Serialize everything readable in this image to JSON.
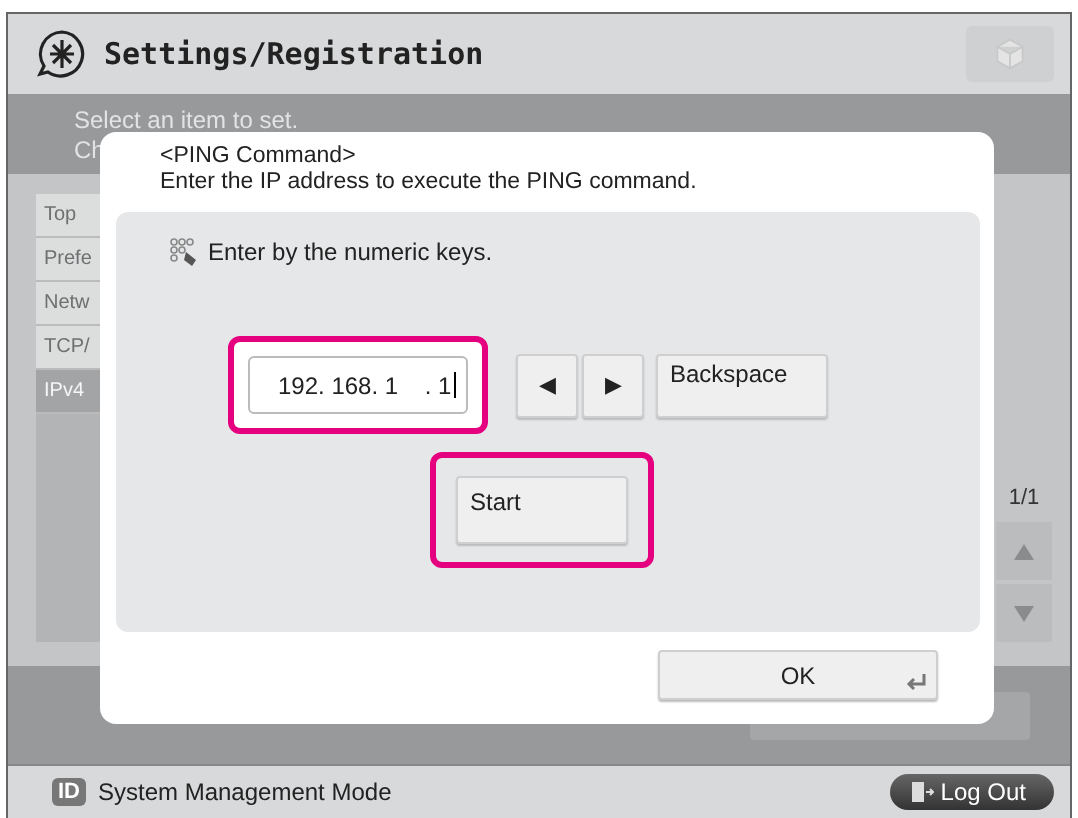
{
  "header": {
    "title": "Settings/Registration"
  },
  "background": {
    "instruction_lines": [
      "Select an item to set.",
      "Ch"
    ],
    "list_items": [
      {
        "label": "Top",
        "selected": false
      },
      {
        "label": "Prefe",
        "selected": false
      },
      {
        "label": "Netw",
        "selected": false
      },
      {
        "label": "TCP/",
        "selected": false
      },
      {
        "label": "IPv4",
        "selected": true
      }
    ],
    "page_indicator": "1/1"
  },
  "dialog": {
    "title": "<PING Command>",
    "message": "Enter the IP address to execute the PING command.",
    "hint": "Enter by the numeric keys.",
    "ip_field": {
      "value": "192. 168. 1    . 1",
      "highlighted": true
    },
    "arrow_keys": [
      "◀",
      "▶"
    ],
    "backspace": "Backspace",
    "start_button": {
      "label": "Start",
      "highlighted": true
    },
    "ok_button": "OK"
  },
  "status_bar": {
    "badge": "ID",
    "mode": "System Management Mode",
    "logout": "Log Out"
  }
}
